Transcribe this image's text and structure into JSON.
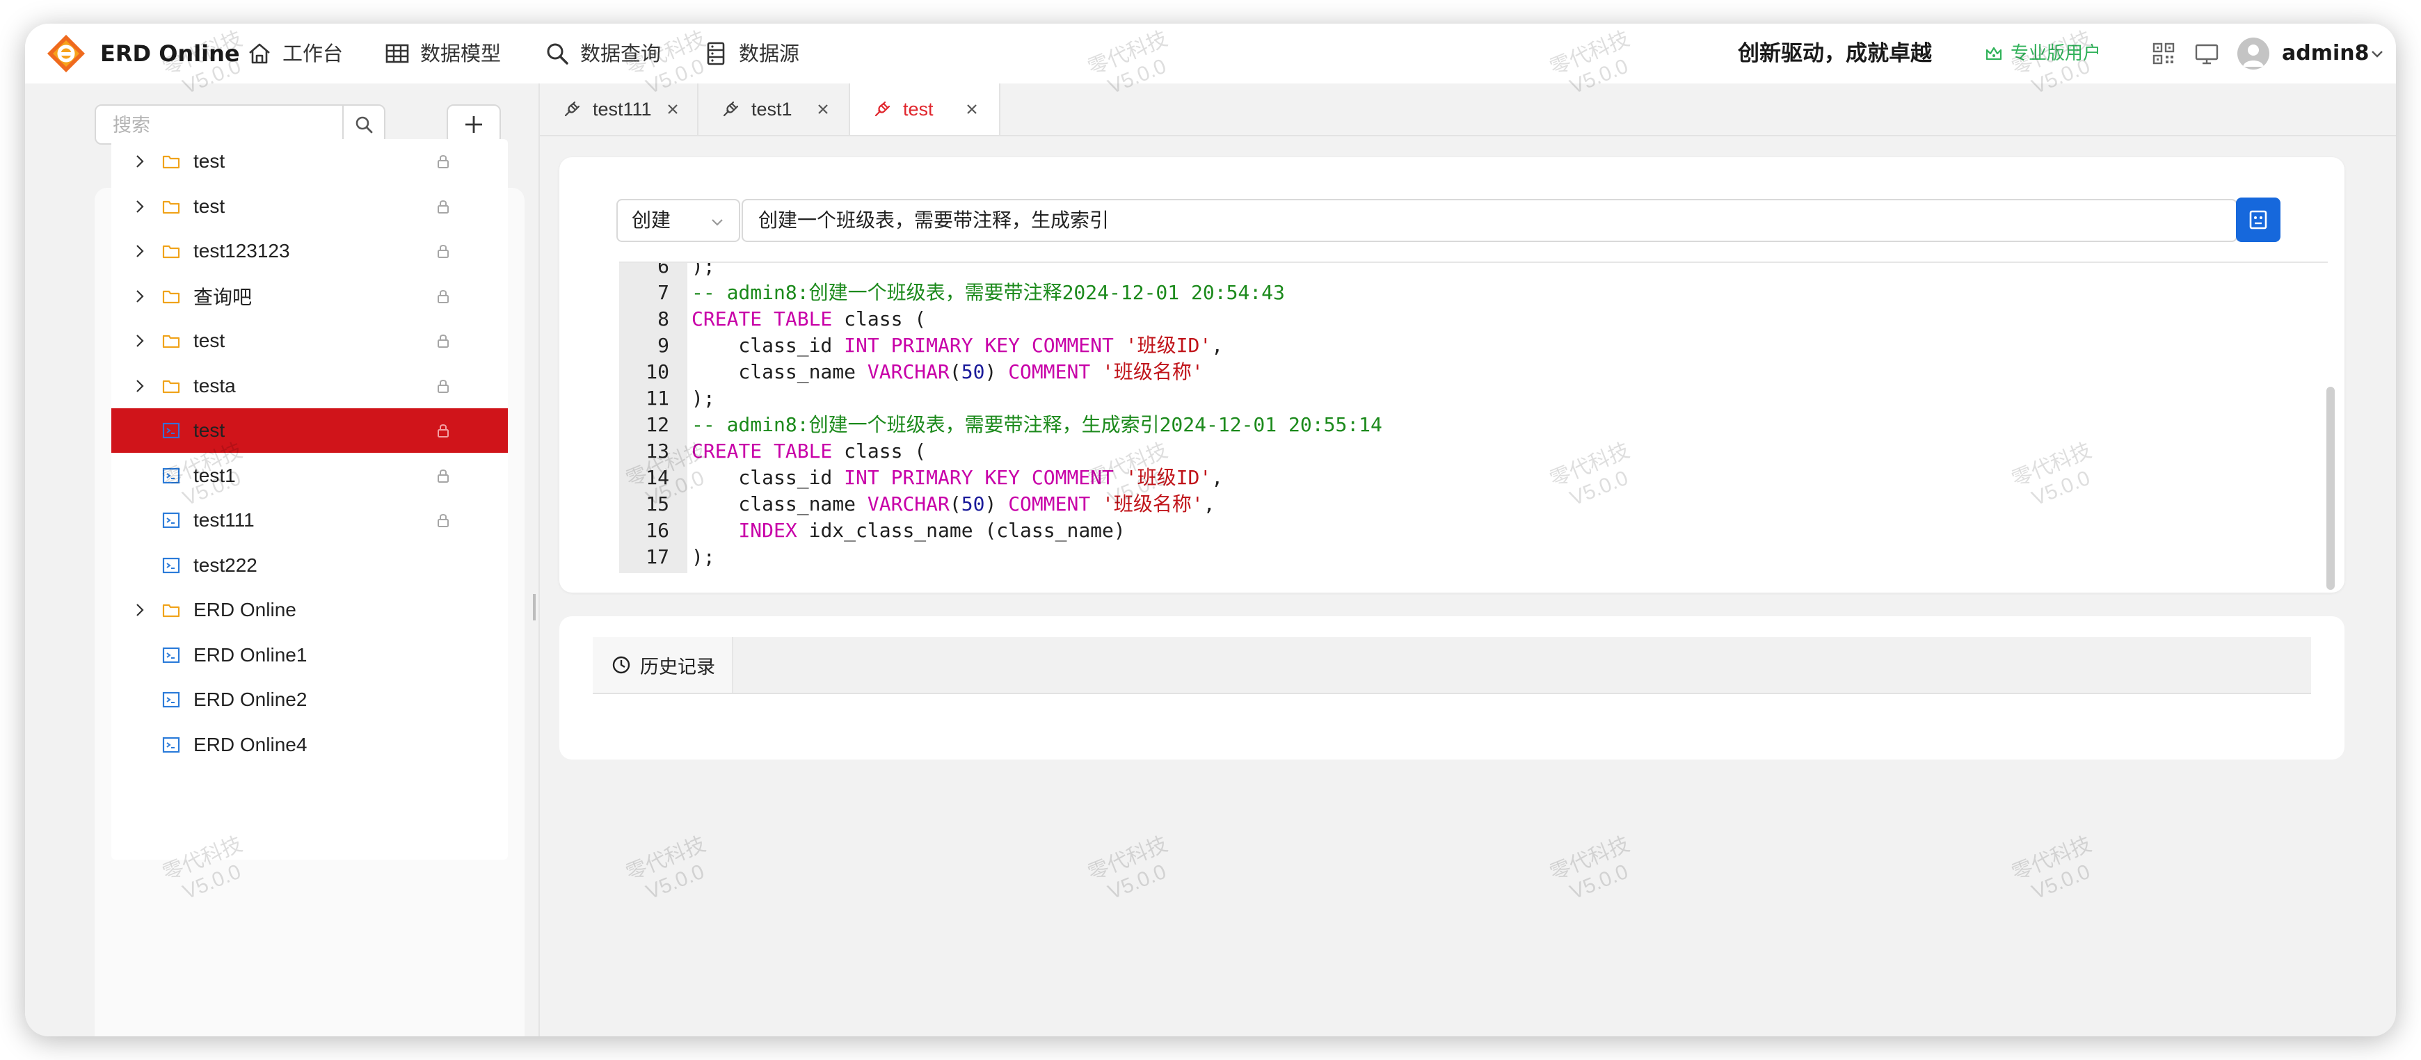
{
  "app": {
    "name": "ERD Online"
  },
  "nav": [
    {
      "label": "工作台",
      "icon": "home-icon"
    },
    {
      "label": "数据模型",
      "icon": "table-icon"
    },
    {
      "label": "数据查询",
      "icon": "search-icon"
    },
    {
      "label": "数据源",
      "icon": "database-icon"
    }
  ],
  "header": {
    "slogan": "创新驱动，成就卓越",
    "pro_label": "专业版用户",
    "username": "admin8"
  },
  "sidebar": {
    "search_placeholder": "搜索",
    "items": [
      {
        "label": "test",
        "type": "folder",
        "expandable": true,
        "locked": true
      },
      {
        "label": "test",
        "type": "folder",
        "expandable": true,
        "locked": true
      },
      {
        "label": "test123123",
        "type": "folder",
        "expandable": true,
        "locked": true
      },
      {
        "label": "查询吧",
        "type": "folder",
        "expandable": true,
        "locked": true
      },
      {
        "label": "test",
        "type": "folder",
        "expandable": true,
        "locked": true
      },
      {
        "label": "testa",
        "type": "folder",
        "expandable": true,
        "locked": true
      },
      {
        "label": "test",
        "type": "query",
        "expandable": false,
        "locked": true,
        "selected": true
      },
      {
        "label": "test1",
        "type": "query",
        "expandable": false,
        "locked": true
      },
      {
        "label": "test111",
        "type": "query",
        "expandable": false,
        "locked": true
      },
      {
        "label": "test222",
        "type": "query",
        "expandable": false,
        "locked": false
      },
      {
        "label": "ERD Online",
        "type": "folder",
        "expandable": true,
        "locked": false
      },
      {
        "label": "ERD Online1",
        "type": "query",
        "expandable": false,
        "locked": false
      },
      {
        "label": "ERD Online2",
        "type": "query",
        "expandable": false,
        "locked": false
      },
      {
        "label": "ERD Online4",
        "type": "query",
        "expandable": false,
        "locked": false
      }
    ]
  },
  "tabs": [
    {
      "label": "test111",
      "active": false
    },
    {
      "label": "test1",
      "active": false
    },
    {
      "label": "test",
      "active": true
    }
  ],
  "editor": {
    "mode": "创建",
    "prompt": "创建一个班级表，需要带注释，生成索引",
    "lines": [
      {
        "n": "6",
        "tokens": [
          {
            "t": ");",
            "c": ""
          }
        ]
      },
      {
        "n": "7",
        "tokens": [
          {
            "t": "-- admin8:创建一个班级表，需要带注释2024-12-01 20:54:43",
            "c": "c"
          }
        ]
      },
      {
        "n": "8",
        "tokens": [
          {
            "t": "CREATE TABLE",
            "c": "k"
          },
          {
            "t": " class (",
            "c": ""
          }
        ]
      },
      {
        "n": "9",
        "tokens": [
          {
            "t": "    class_id ",
            "c": ""
          },
          {
            "t": "INT PRIMARY KEY COMMENT",
            "c": "k"
          },
          {
            "t": " ",
            "c": ""
          },
          {
            "t": "'班级ID'",
            "c": "s"
          },
          {
            "t": ",",
            "c": ""
          }
        ]
      },
      {
        "n": "10",
        "tokens": [
          {
            "t": "    class_name ",
            "c": ""
          },
          {
            "t": "VARCHAR",
            "c": "k"
          },
          {
            "t": "(",
            "c": ""
          },
          {
            "t": "50",
            "c": "n"
          },
          {
            "t": ") ",
            "c": ""
          },
          {
            "t": "COMMENT",
            "c": "k"
          },
          {
            "t": " ",
            "c": ""
          },
          {
            "t": "'班级名称'",
            "c": "s"
          }
        ]
      },
      {
        "n": "11",
        "tokens": [
          {
            "t": ");",
            "c": ""
          }
        ]
      },
      {
        "n": "12",
        "tokens": [
          {
            "t": "-- admin8:创建一个班级表，需要带注释，生成索引2024-12-01 20:55:14",
            "c": "c"
          }
        ]
      },
      {
        "n": "13",
        "tokens": [
          {
            "t": "CREATE TABLE",
            "c": "k"
          },
          {
            "t": " class (",
            "c": ""
          }
        ]
      },
      {
        "n": "14",
        "tokens": [
          {
            "t": "    class_id ",
            "c": ""
          },
          {
            "t": "INT PRIMARY KEY COMMENT",
            "c": "k"
          },
          {
            "t": " ",
            "c": ""
          },
          {
            "t": "'班级ID'",
            "c": "s"
          },
          {
            "t": ",",
            "c": ""
          }
        ]
      },
      {
        "n": "15",
        "tokens": [
          {
            "t": "    class_name ",
            "c": ""
          },
          {
            "t": "VARCHAR",
            "c": "k"
          },
          {
            "t": "(",
            "c": ""
          },
          {
            "t": "50",
            "c": "n"
          },
          {
            "t": ") ",
            "c": ""
          },
          {
            "t": "COMMENT",
            "c": "k"
          },
          {
            "t": " ",
            "c": ""
          },
          {
            "t": "'班级名称'",
            "c": "s"
          },
          {
            "t": ",",
            "c": ""
          }
        ]
      },
      {
        "n": "16",
        "tokens": [
          {
            "t": "    ",
            "c": ""
          },
          {
            "t": "INDEX",
            "c": "k"
          },
          {
            "t": " idx_class_name (class_name)",
            "c": ""
          }
        ]
      },
      {
        "n": "17",
        "tokens": [
          {
            "t": ");",
            "c": ""
          }
        ]
      }
    ]
  },
  "history": {
    "tab_label": "历史记录"
  },
  "watermark": {
    "line1": "零代科技",
    "line2": "V5.0.0"
  },
  "colors": {
    "accent": "#d0141a",
    "primary": "#1668dc",
    "pro": "#31b25a"
  }
}
